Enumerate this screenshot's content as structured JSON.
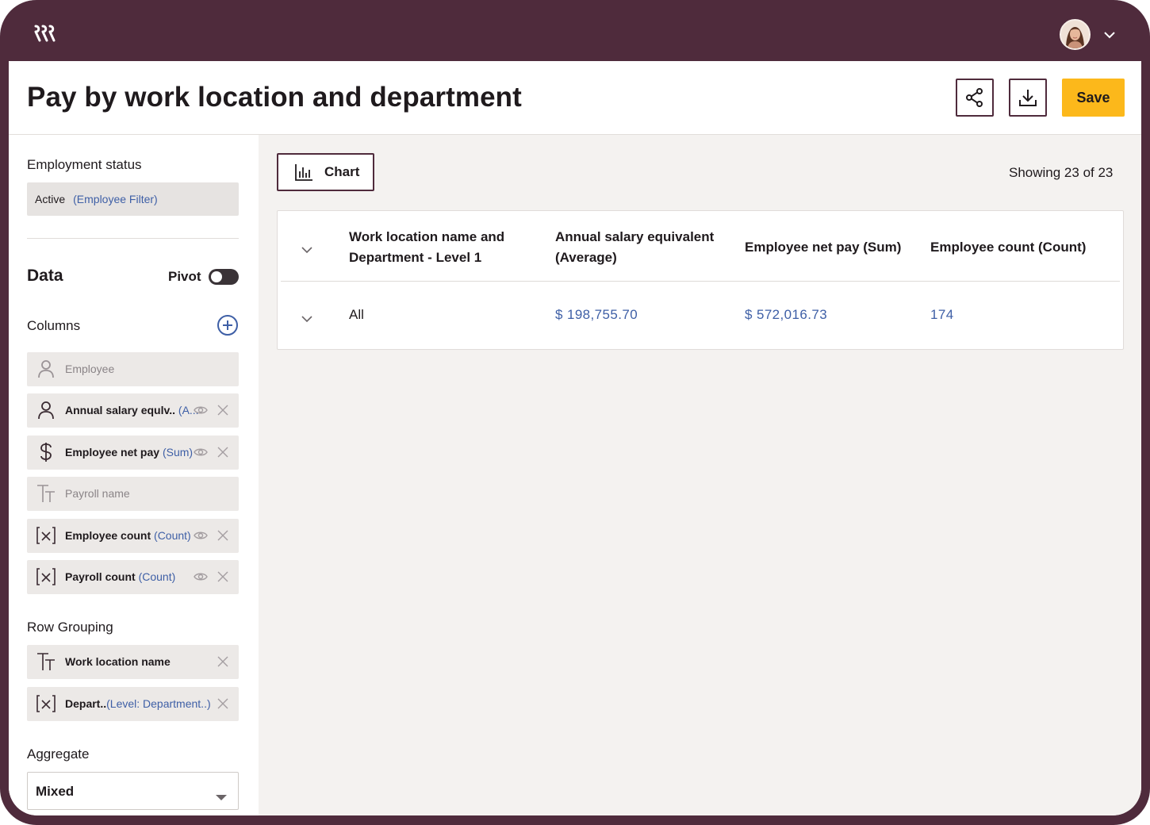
{
  "header": {
    "title": "Pay by work location and department",
    "save_label": "Save"
  },
  "sidebar": {
    "employment_status_label": "Employment status",
    "filter": {
      "value": "Active",
      "type": "(Employee Filter)"
    },
    "data_title": "Data",
    "pivot_label": "Pivot",
    "pivot_on": false,
    "columns_label": "Columns",
    "columns": [
      {
        "icon": "person-icon",
        "label": "Employee",
        "agg": "",
        "active": false
      },
      {
        "icon": "person-icon",
        "label": "Annual salary equlv..",
        "agg": "(A...",
        "active": true
      },
      {
        "icon": "dollar-icon",
        "label": "Employee net pay",
        "agg": "(Sum)",
        "active": true
      },
      {
        "icon": "text-type-icon",
        "label": "Payroll name",
        "agg": "",
        "active": false
      },
      {
        "icon": "formula-icon",
        "label": "Employee count",
        "agg": "(Count)",
        "active": true
      },
      {
        "icon": "formula-icon",
        "label": "Payroll count",
        "agg": "(Count)",
        "active": true
      }
    ],
    "row_grouping_label": "Row Grouping",
    "row_grouping": [
      {
        "icon": "text-type-icon",
        "label": "Work location name",
        "agg": ""
      },
      {
        "icon": "formula-icon",
        "label": "Depart..",
        "agg": "(Level: Department..)"
      }
    ],
    "aggregate_label": "Aggregate",
    "aggregate_value": "Mixed"
  },
  "main": {
    "chart_button_label": "Chart",
    "showing_text": "Showing 23 of 23",
    "table": {
      "headers": [
        "Work location name and Department - Level 1",
        "Annual salary equivalent (Average)",
        "Employee net pay (Sum)",
        "Employee count (Count)"
      ],
      "rows": [
        [
          "All",
          "$ 198,755.70",
          "$ 572,016.73",
          "174"
        ]
      ]
    }
  },
  "colors": {
    "brand": "#4f2b3c",
    "accent": "#fcb81b",
    "link": "#3e5fa6"
  }
}
